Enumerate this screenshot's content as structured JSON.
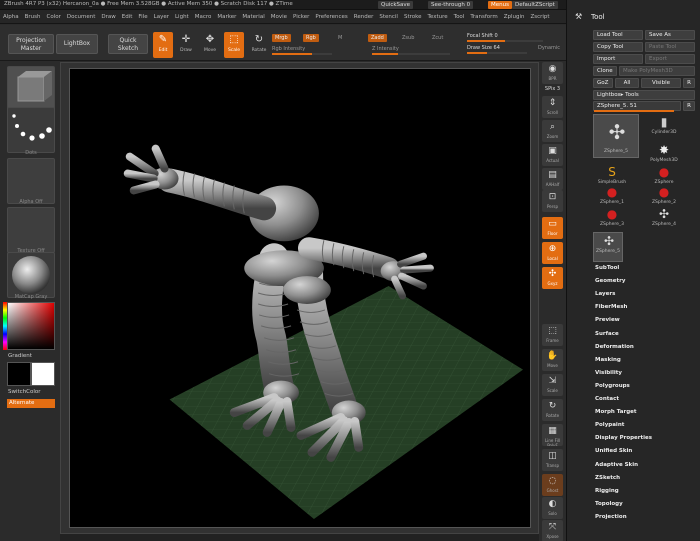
{
  "titlebar": {
    "title": "ZBrush 4R7 P3 (x32)   Hercanon_0a   ● Free Mem 3.528GB ● Active Mem 350 ● Scratch Disk 117 ● ZTime",
    "quicksave": "QuickSave",
    "see_through": "See-through  0",
    "menus": "Menus",
    "default_script": "DefaultZScript"
  },
  "menubar": [
    "Alpha",
    "Brush",
    "Color",
    "Document",
    "Draw",
    "Edit",
    "File",
    "Layer",
    "Light",
    "Macro",
    "Marker",
    "Material",
    "Movie",
    "Picker",
    "Preferences",
    "Render",
    "Stencil",
    "Stroke",
    "Texture",
    "Tool",
    "Transform",
    "Zplugin",
    "Zscript"
  ],
  "shelf": {
    "projection_master": "Projection Master",
    "lightbox": "LightBox",
    "quick_sketch": "Quick Sketch",
    "icons": [
      {
        "label": "Edit",
        "glyph": "✎",
        "on": true
      },
      {
        "label": "Draw",
        "glyph": "✛",
        "on": false
      },
      {
        "label": "Move",
        "glyph": "✥",
        "on": false
      },
      {
        "label": "Scale",
        "glyph": "⬚",
        "on": true
      },
      {
        "label": "Rotate",
        "glyph": "↻",
        "on": false
      }
    ],
    "mrgb": "Mrgb",
    "rgb": "Rgb",
    "m": "M",
    "zadd": "Zadd",
    "zsub": "Zsub",
    "zcut": "Zcut",
    "rgb_intensity": "Rgb Intensity",
    "z_intensity": "Z Intensity",
    "focal_shift_label": "Focal Shift",
    "focal_shift_value": "0",
    "draw_size_label": "Draw Size",
    "draw_size_value": "64",
    "dynamic": "Dynamic"
  },
  "leftshelf": {
    "brush_caption": "",
    "stroke_caption": "Dots",
    "alpha_caption": "Alpha Off",
    "texture_caption": "Texture Off",
    "material_caption": "MatCap Gray",
    "gradient": "Gradient",
    "switch_color": "SwitchColor",
    "alternate": "Alternate"
  },
  "rightshelf": {
    "bpr": "BPR",
    "spix": "SPix 3",
    "buttons": [
      {
        "label": "Scroll",
        "glyph": "⇕"
      },
      {
        "label": "Zoom",
        "glyph": "⌕"
      },
      {
        "label": "Actual",
        "glyph": "▣"
      },
      {
        "label": "AAHalf",
        "glyph": "▤"
      }
    ],
    "persp": "Persp",
    "floor": "Floor",
    "local": "Local",
    "xyz": "Gxyz",
    "frame": "Frame",
    "move": "Move",
    "scale": "Scale",
    "rotate": "Rotate",
    "line_fill": "Line Fill PolyF",
    "transp": "Transp",
    "ghost": "Ghost",
    "solo": "Solo",
    "xpose": "Xpose"
  },
  "tool": {
    "title": "Tool",
    "load_tool": "Load Tool",
    "save_as": "Save As",
    "copy_tool": "Copy Tool",
    "paste_tool": "Paste Tool",
    "import": "Import",
    "export": "Export",
    "clone": "Clone",
    "make_polymesh": "Make PolyMesh3D",
    "goz": "GoZ",
    "all": "All",
    "visible": "Visible",
    "r": "R",
    "lightbox_tools": "Lightbox▸ Tools",
    "current_tool": "ZSphere_5. 51",
    "current_r": "R",
    "thumbs": [
      {
        "label": "ZSphere_5",
        "glyph": "✣",
        "selected": true,
        "big": true
      },
      {
        "label": "Cylinder3D",
        "glyph": "▮",
        "selected": false,
        "big": false
      },
      {
        "label": "PolyMesh3D",
        "glyph": "✸",
        "selected": false,
        "big": false
      },
      {
        "label": "SimpleBrush",
        "glyph": "S",
        "selected": false,
        "big": false
      },
      {
        "label": "ZSphere",
        "glyph": "●",
        "selected": false,
        "big": false
      },
      {
        "label": "ZSphere_1",
        "glyph": "●",
        "selected": false,
        "big": false
      },
      {
        "label": "ZSphere_2",
        "glyph": "●",
        "selected": false,
        "big": false
      },
      {
        "label": "ZSphere_3",
        "glyph": "●",
        "selected": false,
        "big": false
      },
      {
        "label": "ZSphere_4",
        "glyph": "✣",
        "selected": false,
        "big": false
      },
      {
        "label": "ZSphere_5",
        "glyph": "✣",
        "selected": true,
        "big": false
      }
    ],
    "subpalettes": [
      "SubTool",
      "Geometry",
      "Layers",
      "FiberMesh",
      "Preview",
      "Surface",
      "Deformation",
      "Masking",
      "Visibility",
      "Polygroups",
      "Contact",
      "Morph Target",
      "Polypaint",
      "Display Properties",
      "Unified Skin",
      "Adaptive Skin",
      "ZSketch",
      "Rigging",
      "Topology",
      "Projection"
    ]
  },
  "colors": {
    "accent": "#e36d12",
    "floor_grid": "#2b4a2b",
    "model": "#8a8a8a"
  }
}
